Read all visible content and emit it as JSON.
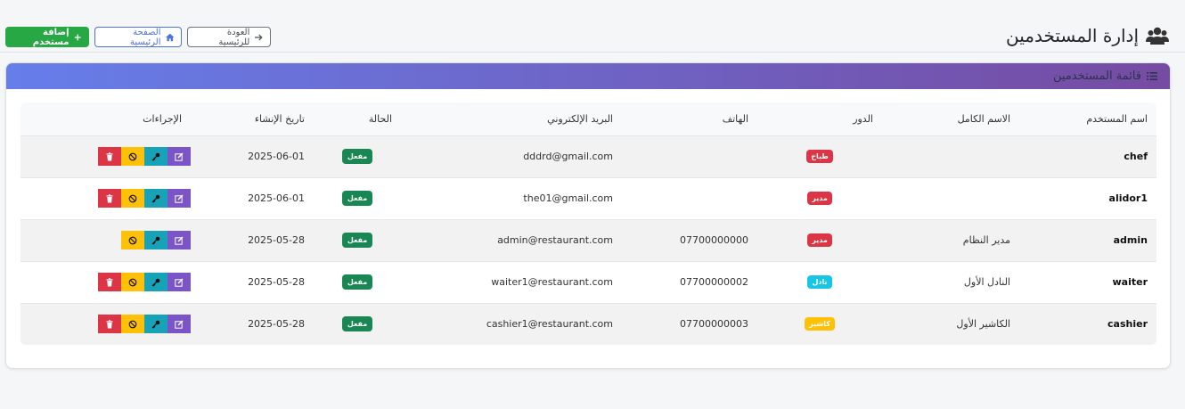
{
  "header": {
    "title": "إدارة المستخدمين",
    "add_label": "إضافة مستخدم",
    "home_label": "الصفحة الرئيسية",
    "back_label": "العودة للرئيسية"
  },
  "card": {
    "title": "قائمة المستخدمين"
  },
  "table": {
    "columns": [
      "اسم المستخدم",
      "الاسم الكامل",
      "الدور",
      "الهاتف",
      "البريد الإلكتروني",
      "الحالة",
      "تاريخ الإنشاء",
      "الإجراءات"
    ],
    "rows": [
      {
        "username": "chef",
        "fullname": "",
        "role": "طباخ",
        "role_color": "#dc3545",
        "phone": "",
        "email": "dddrd@gmail.com",
        "status": "مفعل",
        "created": "2025-06-01",
        "deletable": true
      },
      {
        "username": "alidor1",
        "fullname": "",
        "role": "مدير",
        "role_color": "#dc3545",
        "phone": "",
        "email": "the01@gmail.com",
        "status": "مفعل",
        "created": "2025-06-01",
        "deletable": true
      },
      {
        "username": "admin",
        "fullname": "مدير النظام",
        "role": "مدير",
        "role_color": "#dc3545",
        "phone": "07700000000",
        "email": "admin@restaurant.com",
        "status": "مفعل",
        "created": "2025-05-28",
        "deletable": false
      },
      {
        "username": "waiter",
        "fullname": "النادل الأول",
        "role": "نادل",
        "role_color": "#17c6e4",
        "phone": "07700000002",
        "email": "waiter1@restaurant.com",
        "status": "مفعل",
        "created": "2025-05-28",
        "deletable": true
      },
      {
        "username": "cashier",
        "fullname": "الكاشير الأول",
        "role": "كاشير",
        "role_color": "#ffc107",
        "phone": "07700000003",
        "email": "cashier1@restaurant.com",
        "status": "مفعل",
        "created": "2025-05-28",
        "deletable": true
      }
    ]
  },
  "icons": {
    "title": "users-icon",
    "card": "list-icon",
    "add": "plus-icon",
    "home": "home-icon",
    "back": "arrow-right-icon",
    "edit": "edit-icon",
    "key": "key-icon",
    "ban": "ban-icon",
    "delete": "trash-icon"
  },
  "colors": {
    "gradient_start": "#667eea",
    "gradient_end": "#764ba2",
    "success": "#28a745",
    "danger": "#dc3545",
    "warning": "#ffc107",
    "info": "#17a2b8",
    "primary": "#4e73df"
  }
}
